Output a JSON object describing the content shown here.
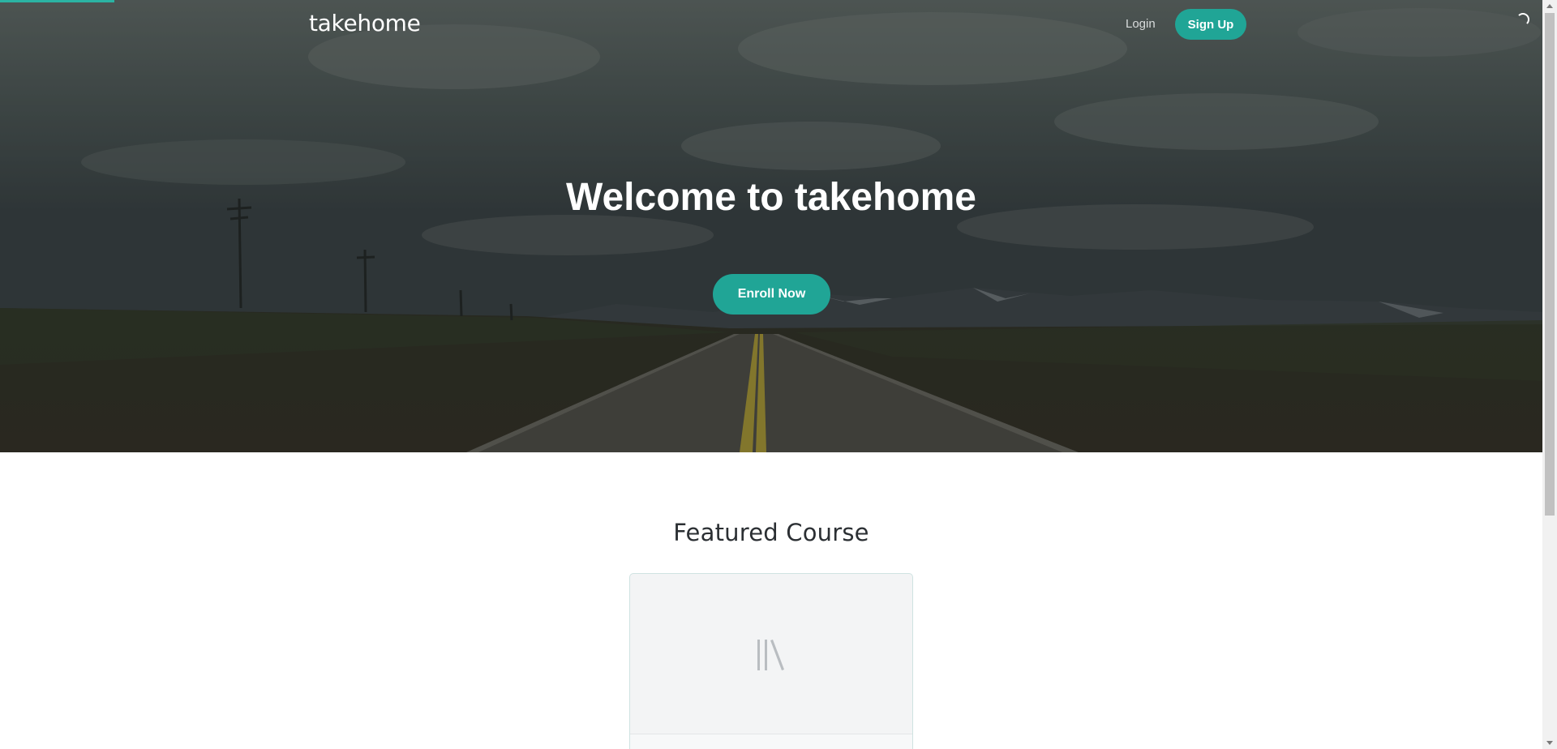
{
  "header": {
    "brand": "takehome",
    "login_label": "Login",
    "signup_label": "Sign Up"
  },
  "hero": {
    "title": "Welcome to takehome",
    "cta_label": "Enroll Now"
  },
  "featured": {
    "title": "Featured Course",
    "placeholder_icon": "course-placeholder-icon"
  },
  "colors": {
    "accent": "#20a596",
    "loading_bar": "#2bb3a3"
  },
  "icons": [
    "loading-spinner-icon",
    "course-placeholder-icon"
  ]
}
